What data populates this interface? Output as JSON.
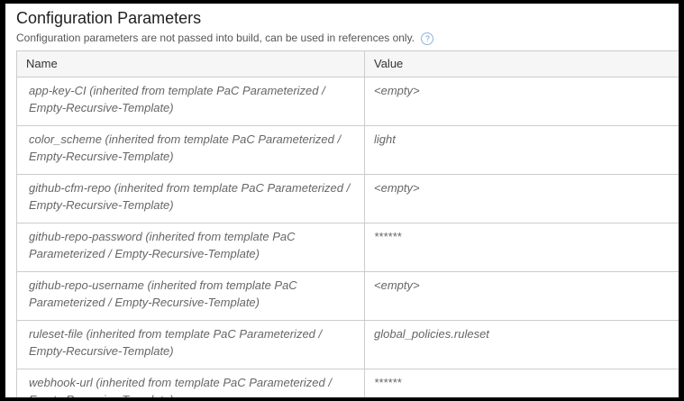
{
  "section": {
    "title": "Configuration Parameters",
    "description": "Configuration parameters are not passed into build, can be used in references only.",
    "help_icon": "?"
  },
  "table": {
    "headers": {
      "name": "Name",
      "value": "Value"
    },
    "rows": [
      {
        "name": "app-key-CI (inherited from template PaC Parameterized / Empty-Recursive-Template)",
        "value": "<empty>"
      },
      {
        "name": "color_scheme (inherited from template PaC Parameterized / Empty-Recursive-Template)",
        "value": "light"
      },
      {
        "name": "github-cfm-repo (inherited from template PaC Parameterized / Empty-Recursive-Template)",
        "value": "<empty>"
      },
      {
        "name": "github-repo-password (inherited from template PaC Parameterized / Empty-Recursive-Template)",
        "value": "******"
      },
      {
        "name": "github-repo-username (inherited from template PaC Parameterized / Empty-Recursive-Template)",
        "value": "<empty>"
      },
      {
        "name": "ruleset-file (inherited from template PaC Parameterized / Empty-Recursive-Template)",
        "value": "global_policies.ruleset"
      },
      {
        "name": "webhook-url (inherited from template PaC Parameterized / Empty-Recursive-Template)",
        "value": "******"
      }
    ]
  }
}
